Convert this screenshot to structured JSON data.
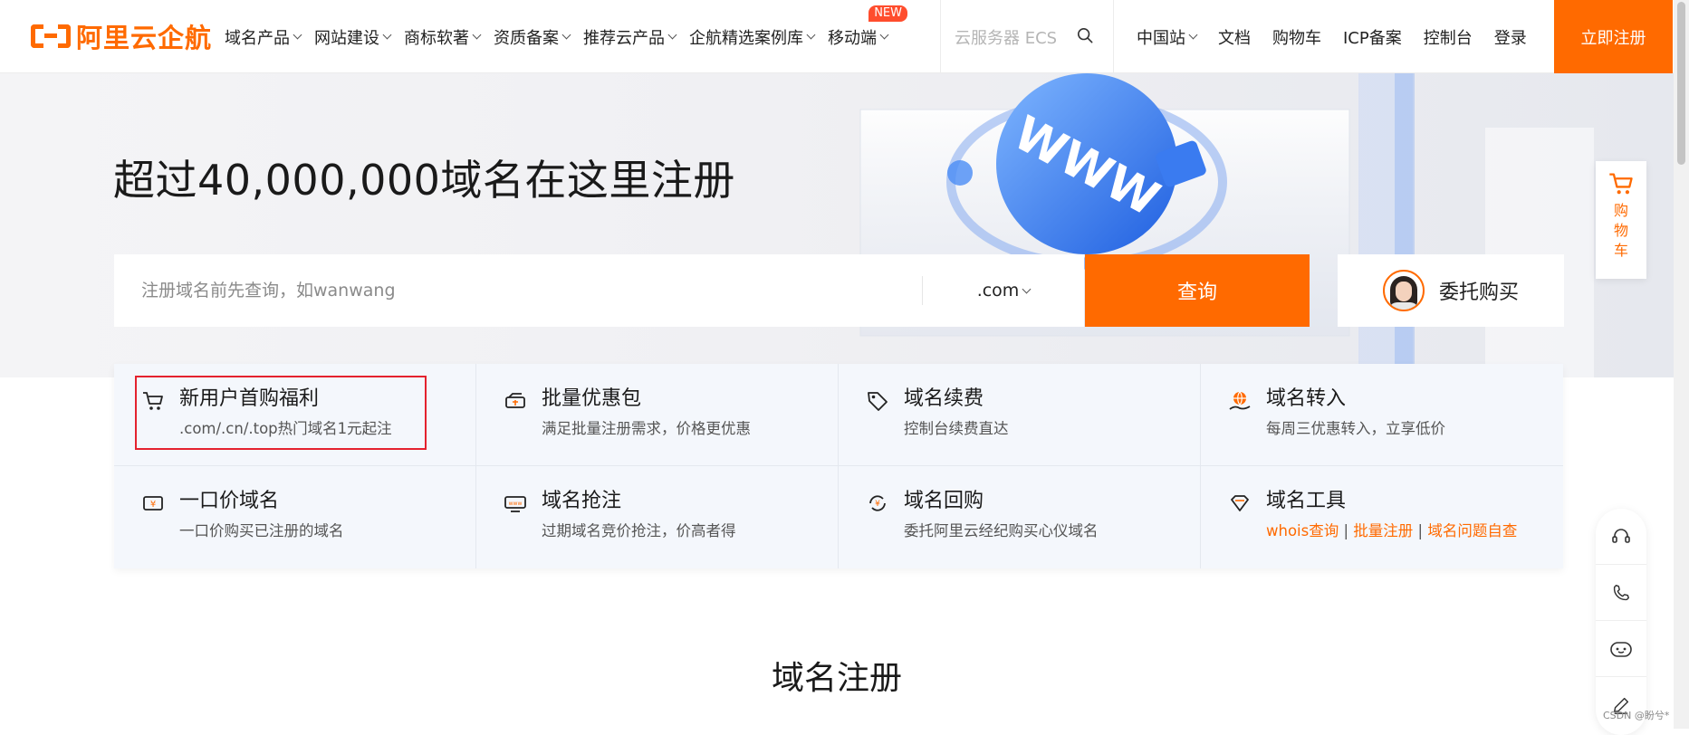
{
  "header": {
    "logo_text": "阿里云企航",
    "nav": [
      {
        "label": "域名产品"
      },
      {
        "label": "网站建设"
      },
      {
        "label": "商标软著"
      },
      {
        "label": "资质备案"
      },
      {
        "label": "推荐云产品"
      },
      {
        "label": "企航精选案例库"
      },
      {
        "label": "移动端",
        "badge": "NEW"
      }
    ],
    "search_placeholder": "云服务器 ECS",
    "right_nav": [
      {
        "label": "中国站",
        "dropdown": true
      },
      {
        "label": "文档"
      },
      {
        "label": "购物车"
      },
      {
        "label": "ICP备案"
      },
      {
        "label": "控制台"
      },
      {
        "label": "登录"
      }
    ],
    "register_label": "立即注册"
  },
  "hero": {
    "title": "超过40,000,000域名在这里注册",
    "search_placeholder": "注册域名前先查询，如wanwang",
    "tld_selected": ".com",
    "query_label": "查询",
    "agent_label": "委托购买"
  },
  "services": [
    {
      "title": "新用户首购福利",
      "desc": ".com/.cn/.top热门域名1元起注",
      "icon": "cart-icon"
    },
    {
      "title": "批量优惠包",
      "desc": "满足批量注册需求，价格更优惠",
      "icon": "coupon-stack-icon"
    },
    {
      "title": "域名续费",
      "desc": "控制台续费直达",
      "icon": "tag-icon"
    },
    {
      "title": "域名转入",
      "desc": "每周三优惠转入，立享低价",
      "icon": "globe-hand-icon"
    },
    {
      "title": "一口价域名",
      "desc": "一口价购买已注册的域名",
      "icon": "price-ticket-icon"
    },
    {
      "title": "域名抢注",
      "desc": "过期域名竞价抢注，价高者得",
      "icon": "www-icon"
    },
    {
      "title": "域名回购",
      "desc": "委托阿里云经纪购买心仪域名",
      "icon": "yen-cycle-icon"
    },
    {
      "title": "域名工具",
      "links": [
        "whois查询",
        "批量注册",
        "域名问题自查"
      ],
      "sep": " | ",
      "icon": "diamond-icon"
    }
  ],
  "section_title": "域名注册",
  "float_cart_label": "购物车",
  "watermark": "CSDN @盼兮*",
  "colors": {
    "accent": "#ff6a00",
    "highlight": "#e4222e"
  }
}
